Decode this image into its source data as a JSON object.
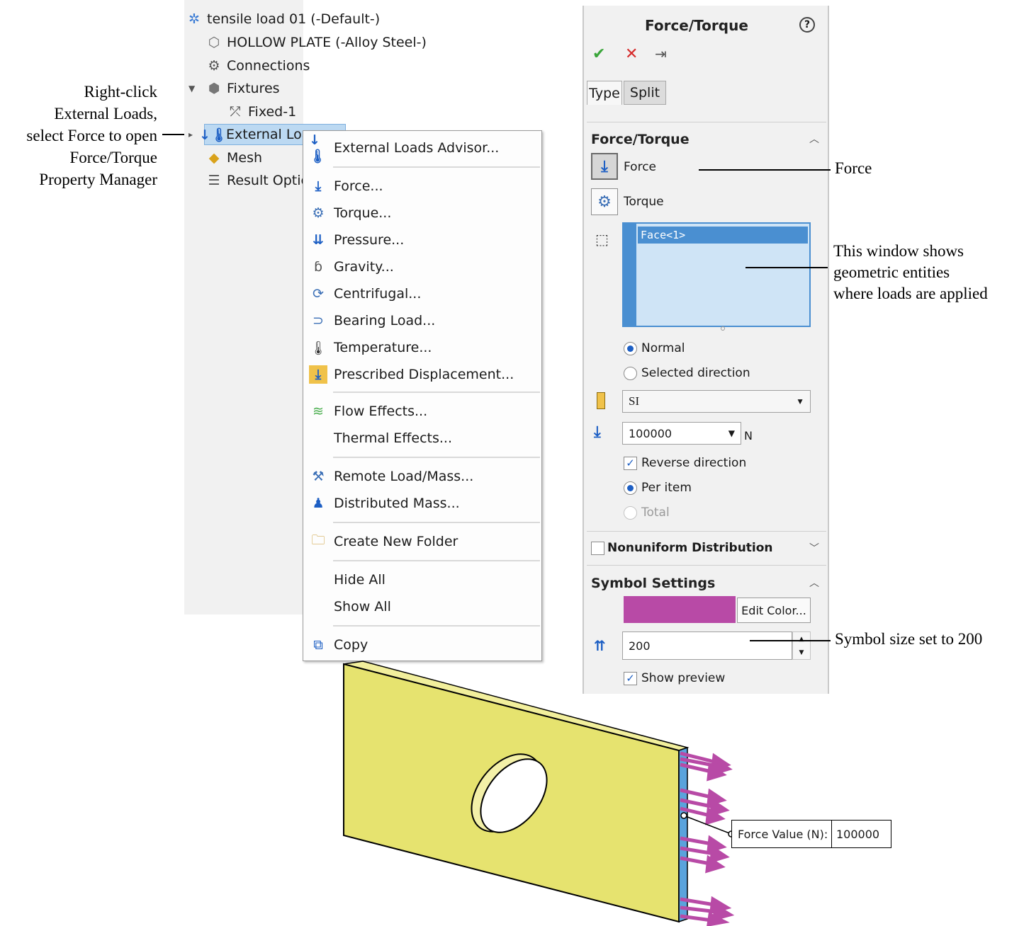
{
  "tree": {
    "items": [
      {
        "label": "tensile load 01 (-Default-)",
        "icon": "study-icon"
      },
      {
        "label": "HOLLOW PLATE (-Alloy Steel-)",
        "icon": "part-icon"
      },
      {
        "label": "Connections",
        "icon": "connections-icon"
      },
      {
        "label": "Fixtures",
        "icon": "fixtures-icon"
      },
      {
        "label": "Fixed-1",
        "icon": "fixed-icon"
      },
      {
        "label": "External Loa",
        "icon": "external-loads-icon"
      },
      {
        "label": "Mesh",
        "icon": "mesh-icon"
      },
      {
        "label": "Result Optic",
        "icon": "result-options-icon"
      }
    ]
  },
  "menu": {
    "items": [
      {
        "label": "External Loads Advisor...",
        "icon": "advisor-icon"
      },
      {
        "label": "Force...",
        "icon": "force-icon"
      },
      {
        "label": "Torque...",
        "icon": "torque-icon"
      },
      {
        "label": "Pressure...",
        "icon": "pressure-icon"
      },
      {
        "label": "Gravity...",
        "icon": "gravity-icon"
      },
      {
        "label": "Centrifugal...",
        "icon": "centrifugal-icon"
      },
      {
        "label": "Bearing Load...",
        "icon": "bearing-load-icon"
      },
      {
        "label": "Temperature...",
        "icon": "temperature-icon"
      },
      {
        "label": "Prescribed Displacement...",
        "icon": "prescribed-displacement-icon"
      },
      {
        "label": "Flow Effects...",
        "icon": "flow-effects-icon"
      },
      {
        "label": "Thermal Effects...",
        "icon": ""
      },
      {
        "label": "Remote Load/Mass...",
        "icon": "remote-load-icon"
      },
      {
        "label": "Distributed Mass...",
        "icon": "distributed-mass-icon"
      },
      {
        "label": "Create New Folder",
        "icon": "folder-icon"
      },
      {
        "label": "Hide All",
        "icon": ""
      },
      {
        "label": "Show All",
        "icon": ""
      },
      {
        "label": "Copy",
        "icon": "copy-icon"
      }
    ]
  },
  "pm": {
    "title": "Force/Torque",
    "help": "?",
    "tabs": [
      "Type",
      "Split"
    ],
    "section_force_torque": "Force/Torque",
    "force_label": "Force",
    "torque_label": "Torque",
    "selection": "Face<1>",
    "normal_label": "Normal",
    "selected_direction_label": "Selected direction",
    "units": "SI",
    "force_value": "100000",
    "force_unit": "N",
    "reverse_direction_label": "Reverse direction",
    "per_item_label": "Per item",
    "total_label": "Total",
    "nonuniform_label": "Nonuniform Distribution",
    "symbol_settings_label": "Symbol Settings",
    "edit_color_label": "Edit Color...",
    "symbol_color": "#b84aa6",
    "symbol_size": "200",
    "show_preview_label": "Show preview"
  },
  "annotations": {
    "right_click": [
      "Right-click",
      "External Loads,",
      "select Force to open",
      "Force/Torque",
      "Property Manager"
    ],
    "force": "Force",
    "window": [
      "This window shows",
      "geometric entities",
      "where loads are applied"
    ],
    "symbol_size": "Symbol size set to 200"
  },
  "callout": {
    "label": "Force Value (N):",
    "value": "100000"
  },
  "colors": {
    "plate": "#e6e36f",
    "edge_face": "#5aa3dc",
    "arrow": "#b84aa6",
    "selection": "#4a8fd1"
  }
}
